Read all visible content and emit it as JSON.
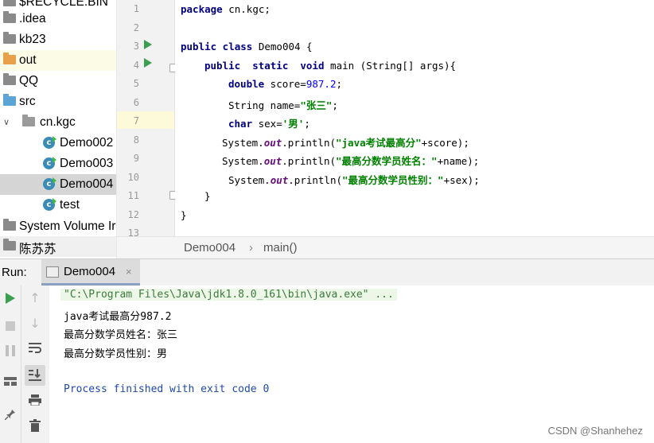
{
  "project_tree": {
    "items": [
      {
        "label": "$RECYCLE.BIN",
        "type": "folder"
      },
      {
        "label": ".idea",
        "type": "folder"
      },
      {
        "label": "kb23",
        "type": "folder"
      },
      {
        "label": "out",
        "type": "folder-excluded"
      },
      {
        "label": "QQ",
        "type": "folder"
      },
      {
        "label": "src",
        "type": "folder-source"
      },
      {
        "label": "cn.kgc",
        "type": "package"
      },
      {
        "label": "Demo002",
        "type": "class"
      },
      {
        "label": "Demo003",
        "type": "class"
      },
      {
        "label": "Demo004",
        "type": "class-selected"
      },
      {
        "label": "test",
        "type": "class"
      },
      {
        "label": "System Volume Ir",
        "type": "folder"
      },
      {
        "label": "陈苏苏",
        "type": "folder"
      }
    ]
  },
  "editor": {
    "line_numbers": [
      "1",
      "2",
      "3",
      "4",
      "5",
      "6",
      "7",
      "8",
      "9",
      "10",
      "11",
      "12",
      "13"
    ],
    "lines": {
      "l1_kw": "package",
      "l1_rest": " cn.kgc;",
      "l3_kw": "public class",
      "l3_rest": " Demo004 {",
      "l4_kw1": "public  static  void",
      "l4_rest": " main (String[] args){",
      "l5_kw": "double",
      "l5_mid": " score=",
      "l5_num": "987.2",
      "l5_end": ";",
      "l6_pre": "String name=",
      "l6_str": "\"张三\"",
      "l6_end": ";",
      "l7_kw": "char",
      "l7_mid": " sex=",
      "l7_str": "'男'",
      "l7_end": ";",
      "l8_pre": "System.",
      "l8_fld": "out",
      "l8_mid": ".println(",
      "l8_str": "\"java考试最高分\"",
      "l8_end": "+score);",
      "l9_pre": "System.",
      "l9_fld": "out",
      "l9_mid": ".println(",
      "l9_str": "\"最高分数学员姓名：\"",
      "l9_end": "+name);",
      "l10_pre": "System.",
      "l10_fld": "out",
      "l10_mid": ".println(",
      "l10_str": "\"最高分数学员性别：\"",
      "l10_end": "+sex);",
      "l11": "}",
      "l12": "}"
    }
  },
  "breadcrumb": {
    "class_name": "Demo004",
    "separator": "›",
    "method": "main()"
  },
  "run_panel": {
    "label": "Run:",
    "tab_label": "Demo004",
    "tab_close": "×"
  },
  "console": {
    "cmd": "\"C:\\Program Files\\Java\\jdk1.8.0_161\\bin\\java.exe\" ...",
    "out1": "java考试最高分987.2",
    "out2": "最高分数学员姓名：张三",
    "out3": "最高分数学员性别：男",
    "exit": "Process finished with exit code 0"
  },
  "watermark": "CSDN @Shanhehez",
  "colors": {
    "keyword": "#000080",
    "string": "#008000",
    "number": "#0000ff",
    "run_green": "#3aa050"
  }
}
